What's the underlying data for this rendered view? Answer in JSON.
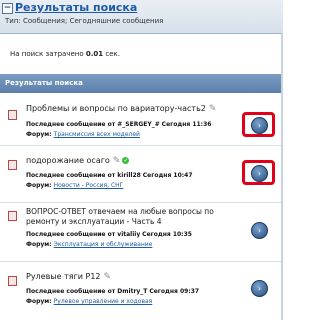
{
  "header": {
    "collapse_symbol": "−",
    "title": "Результаты поиска",
    "subtitle": "Тип: Сообщения; Сегодняшние сообщения"
  },
  "search_time": {
    "prefix": "На поиск затрачено ",
    "value": "0.01",
    "suffix": " сек."
  },
  "results_label": "Результаты поиска",
  "labels": {
    "last_post": "Последнее сообщение от ",
    "forum": "Форум: "
  },
  "results": [
    {
      "topic": "Проблемы и вопросы по вариатору-часть2",
      "author": "#_SERGEY_#",
      "time": "Сегодня 11:36",
      "forum": "Трансмиссия всех моделей",
      "has_edit_icon": true,
      "has_ok_icon": false,
      "highlighted": true
    },
    {
      "topic": "подорожание осаго",
      "author": "kirill28",
      "time": "Сегодня 10:47",
      "forum": "Новости - Россия, СНГ",
      "has_edit_icon": true,
      "has_ok_icon": true,
      "highlighted": true
    },
    {
      "topic": "ВОПРОС-ОТВЕТ отвечаем на любые вопросы по ремонту и эксплуатации - Часть 4",
      "author": "vitaliiy",
      "time": "Сегодня 10:35",
      "forum": "Эксплуатация и обслуживание",
      "has_edit_icon": false,
      "has_ok_icon": false,
      "highlighted": false
    },
    {
      "topic": "Рулевые тяги P12",
      "author": "Dmitry_T",
      "time": "Сегодня 09:37",
      "forum": "Рулевое управление и ходовая",
      "has_edit_icon": true,
      "has_ok_icon": false,
      "highlighted": false
    }
  ],
  "icons": {
    "go": "go-to-post-icon",
    "edit": "pencil-icon",
    "ok": "checkmark-icon",
    "document": "thread-icon"
  },
  "colors": {
    "link": "#1f5aa5",
    "results_bar": "#6a8db8",
    "highlight": "#e0001a"
  }
}
